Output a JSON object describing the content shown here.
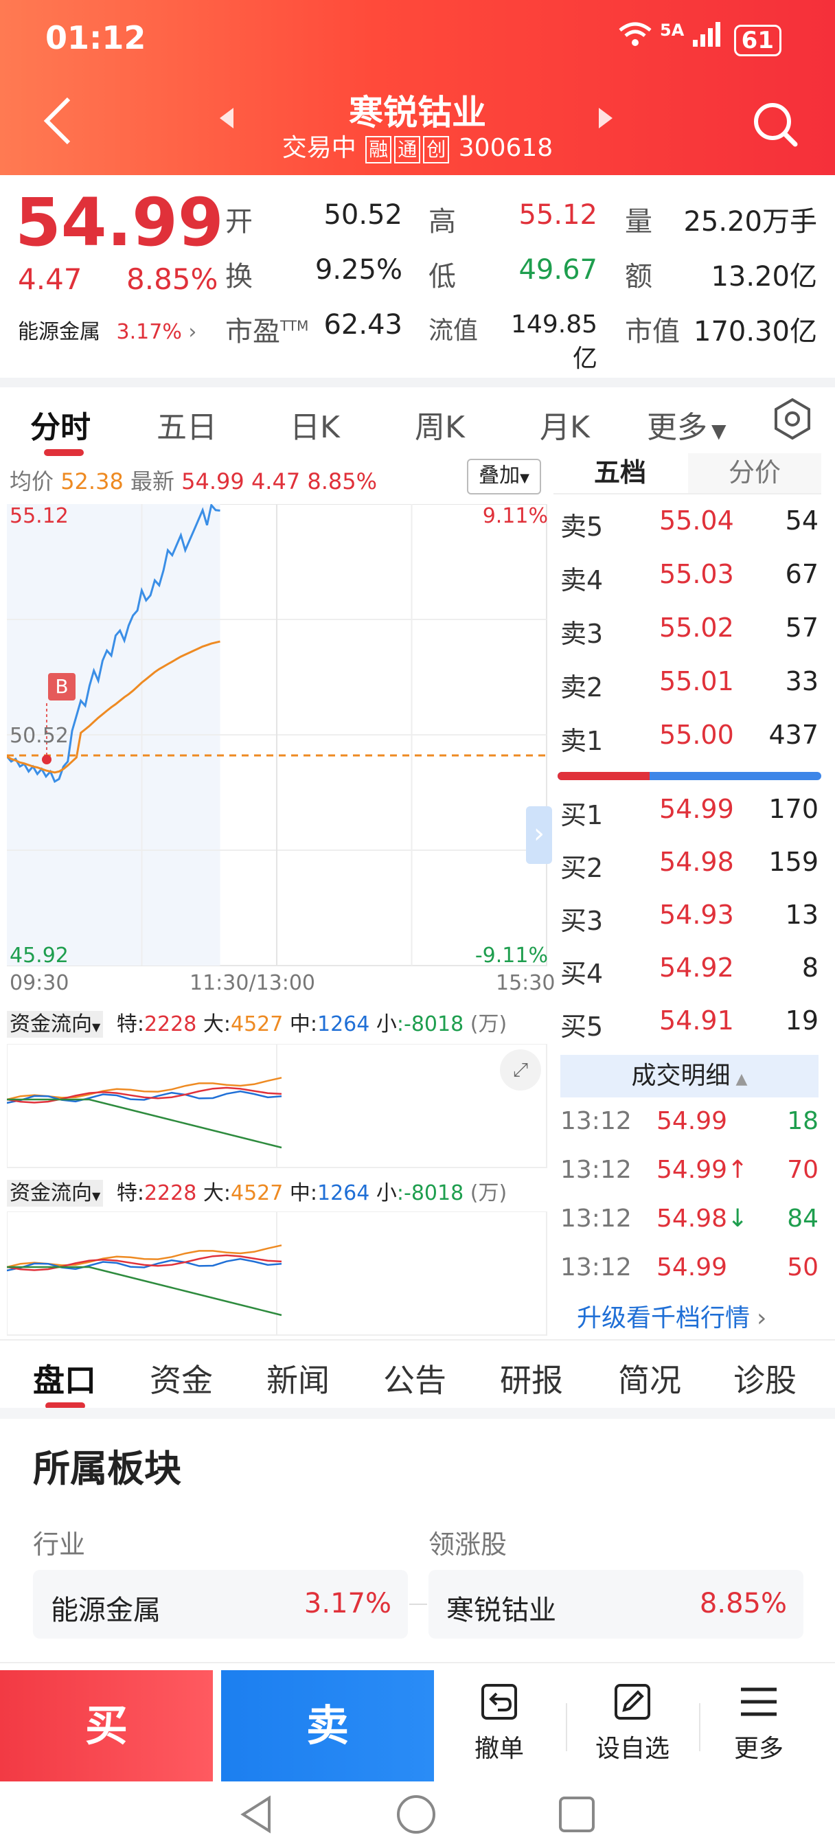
{
  "status": {
    "time": "01:12",
    "network": "5A",
    "battery": "61"
  },
  "header": {
    "title": "寒锐钴业",
    "trade_status": "交易中",
    "tags": [
      "融",
      "通",
      "创"
    ],
    "code": "300618"
  },
  "quote": {
    "price": "54.99",
    "change": "4.47",
    "change_pct": "8.85%",
    "sector_name": "能源金属",
    "sector_pct": "3.17%",
    "open_label": "开",
    "open": "50.52",
    "high_label": "高",
    "high": "55.12",
    "volume_label": "量",
    "volume": "25.20万手",
    "turnover_label": "换",
    "turnover": "9.25%",
    "low_label": "低",
    "low": "49.67",
    "amount_label": "额",
    "amount": "13.20亿",
    "pe_label": "市盈",
    "pe_sup": "TTM",
    "pe": "62.43",
    "float_label": "流值",
    "float_value": "149.85亿",
    "mcap_label": "市值",
    "mcap": "170.30亿"
  },
  "chart_tabs": [
    "分时",
    "五日",
    "日K",
    "周K",
    "月K",
    "更多"
  ],
  "chart_info": {
    "avg_label": "均价",
    "avg": "52.38",
    "latest_label": "最新",
    "latest": "54.99",
    "change": "4.47",
    "change_pct": "8.85%",
    "overlay_label": "叠加"
  },
  "chart_data": {
    "type": "line",
    "y_top_label": "55.12",
    "y_mid_label": "50.52",
    "y_bottom_label": "45.92",
    "pct_top_label": "9.11%",
    "pct_bottom_label": "-9.11%",
    "x_labels": [
      "09:30",
      "11:30/13:00",
      "15:30"
    ],
    "ylim": [
      45.92,
      55.12
    ],
    "prev_close": 50.52,
    "marker": "B",
    "series": [
      {
        "values": [
          50.5,
          50.4,
          50.45,
          50.3,
          50.35,
          50.2,
          50.3,
          50.15,
          50.25,
          50.1,
          50.2,
          50.0,
          50.05,
          50.3,
          50.4,
          50.6,
          50.9,
          51.2,
          51.1,
          51.5,
          51.8,
          51.6,
          52.0,
          52.2,
          52.1,
          52.5,
          52.6,
          52.4,
          52.7,
          52.9,
          53.0,
          53.4,
          53.2,
          53.3,
          53.6,
          53.5,
          53.8,
          54.2,
          54.1,
          54.3,
          54.5,
          54.2,
          54.4,
          54.6,
          54.8,
          55.0,
          54.7,
          55.1,
          55.0,
          54.99
        ]
      },
      {
        "values": [
          50.5,
          50.45,
          50.42,
          50.38,
          50.36,
          50.33,
          50.3,
          50.28,
          50.25,
          50.22,
          50.2,
          50.18,
          50.2,
          50.25,
          50.32,
          50.4,
          50.48,
          50.56,
          50.63,
          50.7,
          50.78,
          50.86,
          50.93,
          51.0,
          51.07,
          51.13,
          51.2,
          51.27,
          51.33,
          51.4,
          51.48,
          51.56,
          51.63,
          51.7,
          51.77,
          51.83,
          51.88,
          51.93,
          51.98,
          52.03,
          52.08,
          52.12,
          52.16,
          52.2,
          52.24,
          52.28,
          52.31,
          52.34,
          52.36,
          52.38
        ]
      }
    ]
  },
  "fund_flow": {
    "label": "资金流向",
    "special_label": "特",
    "special": "2228",
    "large_label": "大",
    "large": "4527",
    "medium_label": "中",
    "medium": "1264",
    "small_label": "小",
    "small": "-8018",
    "unit": "(万)"
  },
  "orderbook": {
    "tab_active": "五档",
    "tab_other": "分价",
    "asks": [
      {
        "label": "卖5",
        "price": "55.04",
        "vol": "54"
      },
      {
        "label": "卖4",
        "price": "55.03",
        "vol": "67"
      },
      {
        "label": "卖3",
        "price": "55.02",
        "vol": "57"
      },
      {
        "label": "卖2",
        "price": "55.01",
        "vol": "33"
      },
      {
        "label": "卖1",
        "price": "55.00",
        "vol": "437"
      }
    ],
    "bids": [
      {
        "label": "买1",
        "price": "54.99",
        "vol": "170"
      },
      {
        "label": "买2",
        "price": "54.98",
        "vol": "159"
      },
      {
        "label": "买3",
        "price": "54.93",
        "vol": "13"
      },
      {
        "label": "买4",
        "price": "54.92",
        "vol": "8"
      },
      {
        "label": "买5",
        "price": "54.91",
        "vol": "19"
      }
    ],
    "ratio_sell": 0.35
  },
  "trades": {
    "title": "成交明细",
    "rows": [
      {
        "time": "13:12",
        "price": "54.99",
        "arrow": "",
        "vol": "18",
        "dir": "green"
      },
      {
        "time": "13:12",
        "price": "54.99",
        "arrow": "↑",
        "vol": "70",
        "dir": "red"
      },
      {
        "time": "13:12",
        "price": "54.98",
        "arrow": "↓",
        "vol": "84",
        "dir": "green"
      },
      {
        "time": "13:12",
        "price": "54.99",
        "arrow": "",
        "vol": "50",
        "dir": "red"
      }
    ],
    "upgrade": "升级看千档行情"
  },
  "info_tabs": [
    "盘口",
    "资金",
    "新闻",
    "公告",
    "研报",
    "简况",
    "诊股"
  ],
  "sector_section": {
    "title": "所属板块",
    "industry_label": "行业",
    "leader_label": "领涨股",
    "industry_name": "能源金属",
    "industry_pct": "3.17%",
    "leader_name": "寒锐钴业",
    "leader_pct": "8.85%"
  },
  "bottom_bar": {
    "buy": "买",
    "sell": "卖",
    "cancel": "撤单",
    "watchlist": "设自选",
    "more": "更多"
  }
}
